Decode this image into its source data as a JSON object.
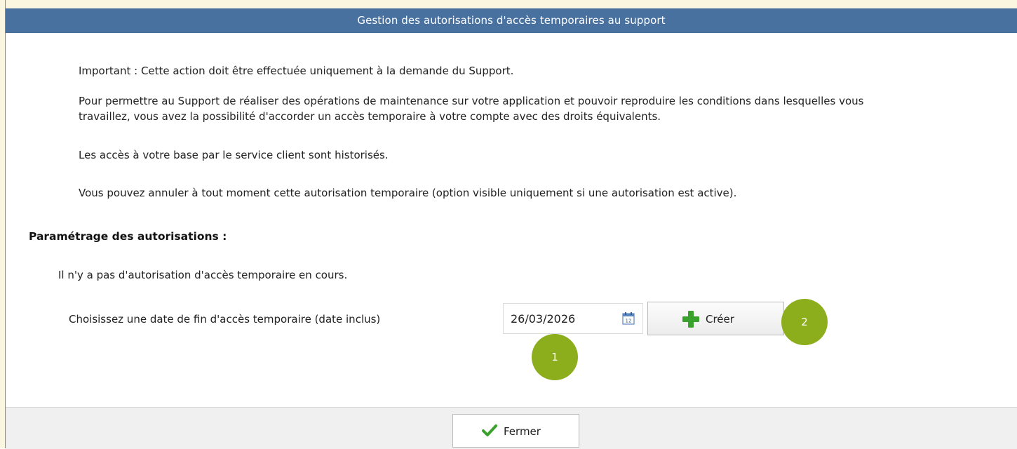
{
  "dialog": {
    "title": "Gestion des autorisations d'accès temporaires au support"
  },
  "intro": {
    "important": "Important : Cette action doit être effectuée uniquement à la demande du Support.",
    "description_line1": "Pour permettre au Support de réaliser des opérations de maintenance sur votre application et pouvoir reproduire les conditions dans lesquelles vous",
    "description_line2": "travaillez, vous avez la possibilité d'accorder un accès temporaire à votre compte avec des droits équivalents.",
    "history": "Les accès à votre base par le service client sont historisés.",
    "cancel_info": "Vous pouvez annuler à tout moment cette autorisation temporaire (option visible uniquement si une autorisation est active)."
  },
  "settings": {
    "section_title": "Paramétrage des autorisations :",
    "status_text": "Il n'y a pas d'autorisation d'accès temporaire en cours.",
    "date_label": "Choisissez une date de fin d'accès temporaire (date inclus)",
    "date_value": "26/03/2026",
    "calendar_icon": "calendar-icon",
    "calendar_icon_text": "12",
    "create_button_label": "Créer",
    "create_icon": "plus-icon"
  },
  "annotations": {
    "badge_1": "1",
    "badge_2": "2"
  },
  "footer": {
    "close_button_label": "Fermer",
    "close_icon": "check-icon"
  },
  "colors": {
    "title_bar": "#49719f",
    "badge": "#8cad1c",
    "plus_icon": "#3aa12c",
    "check_icon": "#3aa12c",
    "footer_bg": "#f0f0f0"
  }
}
